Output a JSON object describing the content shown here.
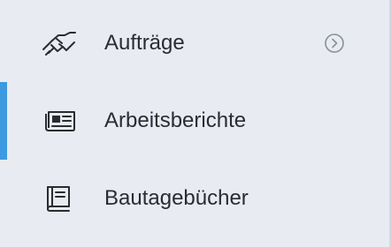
{
  "colors": {
    "background": "#e8ebf2",
    "text": "#2a2c31",
    "icon": "#2a2c31",
    "chevron": "#8a8f99",
    "active_accent": "#3d9ae0"
  },
  "sidebar": {
    "items": [
      {
        "label": "Aufträge",
        "icon": "handshake-icon",
        "has_chevron": true,
        "active": false
      },
      {
        "label": "Arbeitsberichte",
        "icon": "newspaper-icon",
        "has_chevron": false,
        "active": true
      },
      {
        "label": "Bautagebücher",
        "icon": "book-icon",
        "has_chevron": false,
        "active": false
      }
    ]
  }
}
